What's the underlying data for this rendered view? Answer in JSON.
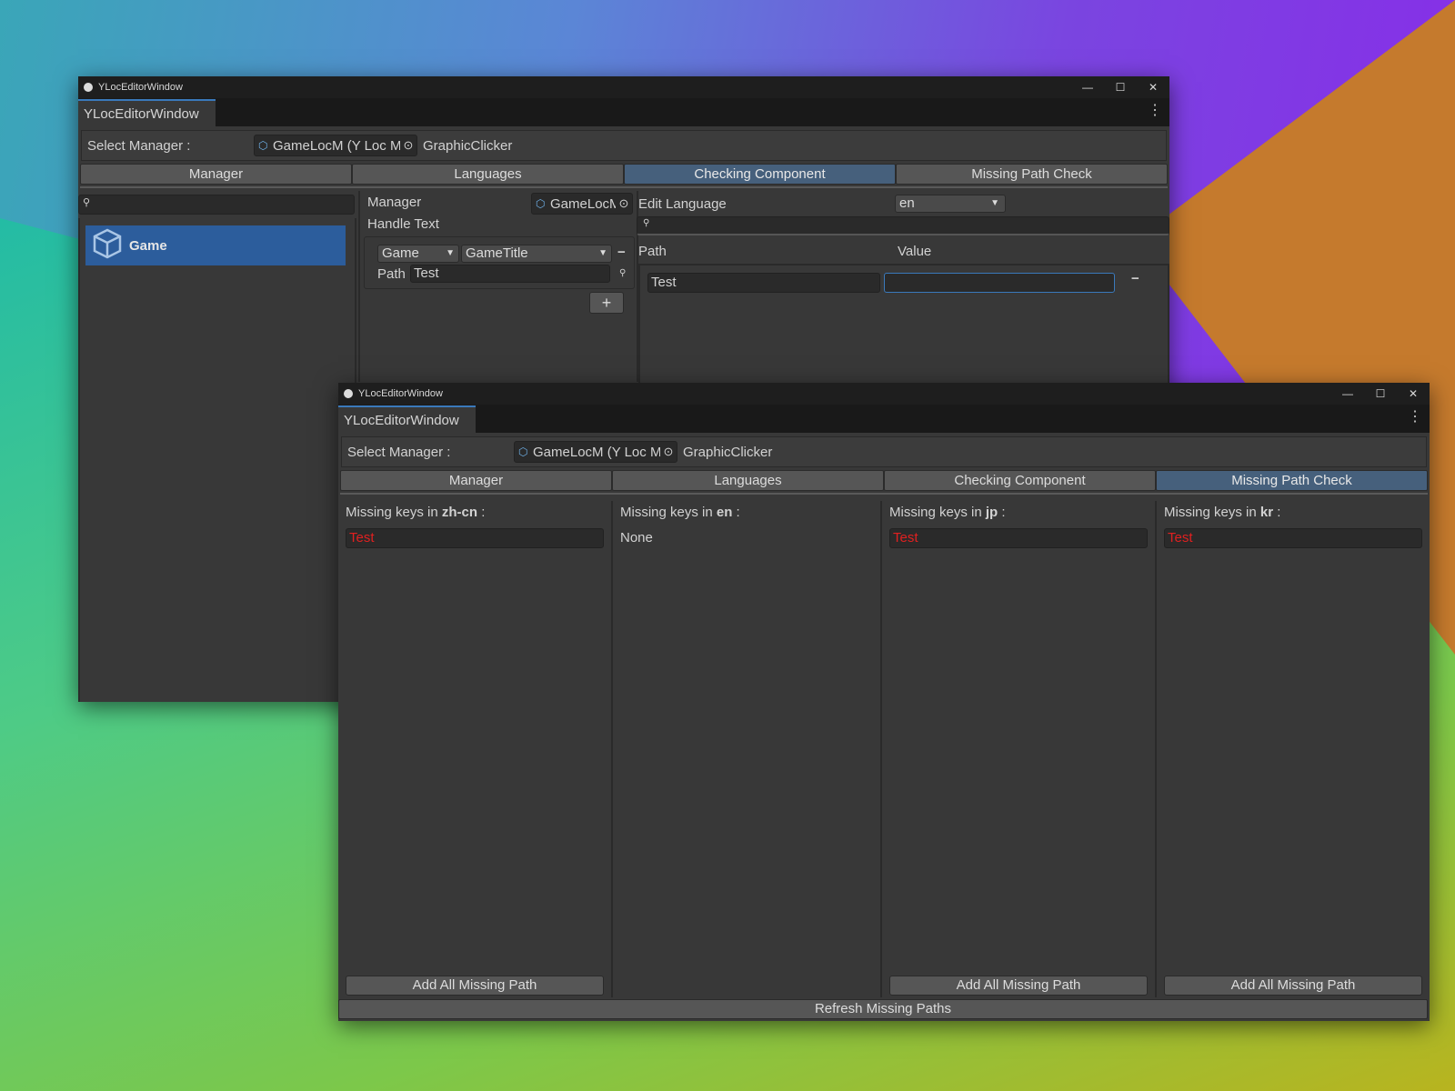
{
  "window_title": "YLocEditorWindow",
  "tab_label": "YLocEditorWindow",
  "select_manager_label": "Select Manager :",
  "manager_object": "GameLocM (Y Loc M",
  "manager_object_after": "GraphicClicker",
  "toolbar": {
    "manager": "Manager",
    "languages": "Languages",
    "checking_component": "Checking Component",
    "missing_path_check": "Missing Path Check"
  },
  "back": {
    "list_item": "Game",
    "manager_label": "Manager",
    "manager_field": "GameLocM",
    "handle_text_label": "Handle Text",
    "dropdown1": "Game",
    "dropdown2": "GameTitle",
    "path_label": "Path",
    "path_value": "Test",
    "add_symbol": "+",
    "minus_symbol": "−",
    "edit_language_label": "Edit Language",
    "edit_language_value": "en",
    "col_path": "Path",
    "col_value": "Value",
    "row_path": "Test",
    "row_value": ""
  },
  "front": {
    "columns": [
      {
        "prefix": "Missing keys in ",
        "lang": "zh-cn",
        "suffix": " :",
        "item": "Test",
        "button": "Add All Missing Path"
      },
      {
        "prefix": "Missing keys in ",
        "lang": "en",
        "suffix": " :",
        "none": "None"
      },
      {
        "prefix": "Missing keys in ",
        "lang": "jp",
        "suffix": " :",
        "item": "Test",
        "button": "Add All Missing Path"
      },
      {
        "prefix": "Missing keys in ",
        "lang": "kr",
        "suffix": " :",
        "item": "Test",
        "button": "Add All Missing Path"
      }
    ],
    "refresh_button": "Refresh Missing Paths"
  },
  "colors": {
    "accent": "#3a79bb",
    "active_tab": "#46607c",
    "missing_text": "#e02020",
    "selected_item": "#2c5d9c"
  }
}
